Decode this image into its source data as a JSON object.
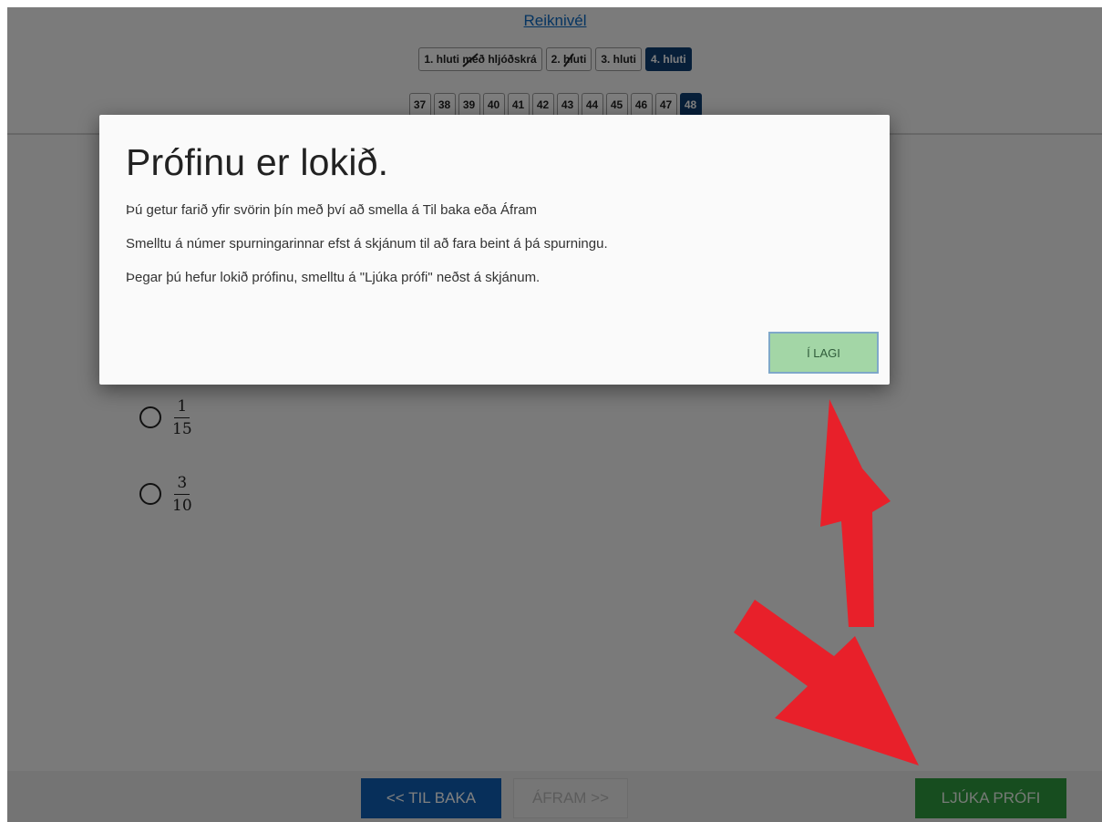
{
  "header": {
    "calculator_link": "Reiknivél",
    "parts": [
      {
        "label": "1. hluti með hljóðskrá",
        "active": false
      },
      {
        "label": "2. hluti",
        "active": false
      },
      {
        "label": "3. hluti",
        "active": false
      },
      {
        "label": "4. hluti",
        "active": true
      }
    ],
    "questions": [
      "37",
      "38",
      "39",
      "40",
      "41",
      "42",
      "43",
      "44",
      "45",
      "46",
      "47",
      "48"
    ],
    "active_question": "48"
  },
  "answers": [
    {
      "numerator": "1",
      "denominator": "15"
    },
    {
      "numerator": "3",
      "denominator": "10"
    }
  ],
  "footer": {
    "back_label": "<< TIL BAKA",
    "next_label": "ÁFRAM >>",
    "finish_label": "LJÚKA PRÓFI"
  },
  "modal": {
    "title": "Prófinu er lokið.",
    "lines": [
      "Þú getur farið yfir svörin þín með því að smella á Til baka eða Áfram",
      "Smelltu á númer spurningarinnar efst á skjánum til að fara beint á þá spurningu.",
      "Þegar þú hefur lokið prófinu, smelltu á \"Ljúka prófi\" neðst á skjánum."
    ],
    "ok_label": "Í LAGI"
  },
  "colors": {
    "primary_blue": "#0e5fb4",
    "active_nav": "#0e3e73",
    "finish_green": "#2f9a3e",
    "ok_green": "#a3d6a6",
    "annotation_red": "#e8202a"
  }
}
